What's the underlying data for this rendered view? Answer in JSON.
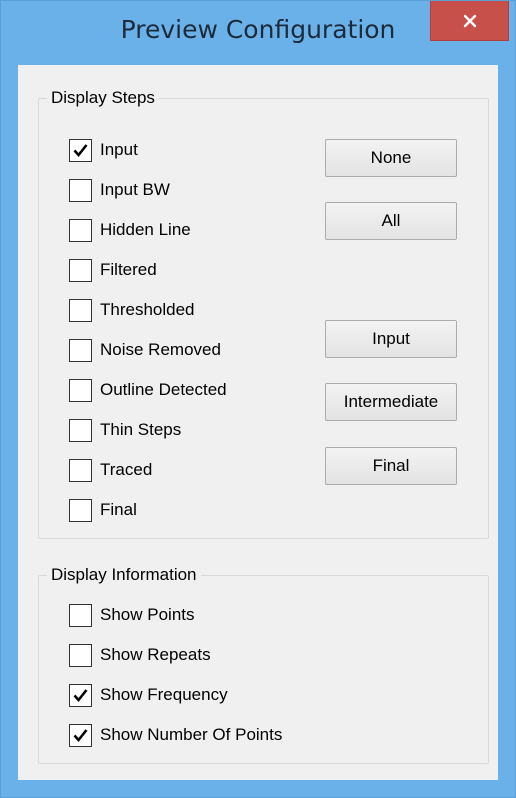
{
  "window": {
    "title": "Preview Configuration",
    "close_icon": "close-icon",
    "colors": {
      "titlebar": "#6ab1ea",
      "close_button": "#c7504b",
      "client": "#f0f0f0"
    }
  },
  "display_steps": {
    "legend": "Display Steps",
    "items": [
      {
        "label": "Input",
        "checked": true
      },
      {
        "label": "Input BW",
        "checked": false
      },
      {
        "label": "Hidden Line",
        "checked": false
      },
      {
        "label": "Filtered",
        "checked": false
      },
      {
        "label": "Thresholded",
        "checked": false
      },
      {
        "label": "Noise Removed",
        "checked": false
      },
      {
        "label": "Outline Detected",
        "checked": false
      },
      {
        "label": "Thin Steps",
        "checked": false
      },
      {
        "label": "Traced",
        "checked": false
      },
      {
        "label": "Final",
        "checked": false
      }
    ],
    "buttons": {
      "none": "None",
      "all": "All",
      "input": "Input",
      "intermediate": "Intermediate",
      "final": "Final"
    }
  },
  "display_information": {
    "legend": "Display Information",
    "items": [
      {
        "label": "Show Points",
        "checked": false
      },
      {
        "label": "Show Repeats",
        "checked": false
      },
      {
        "label": "Show Frequency",
        "checked": true
      },
      {
        "label": "Show Number Of Points",
        "checked": true
      }
    ]
  }
}
